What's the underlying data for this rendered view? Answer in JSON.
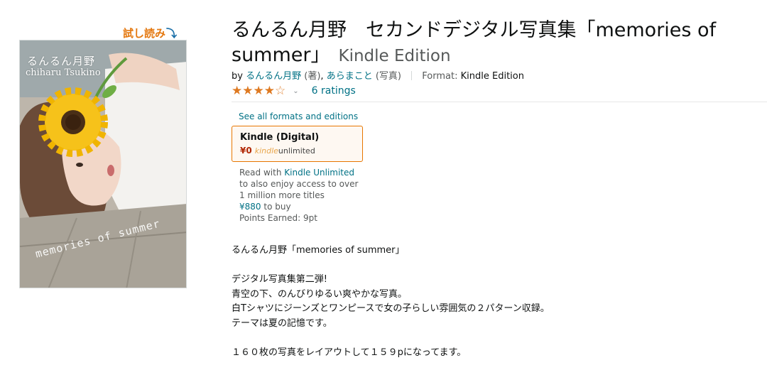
{
  "look_inside": {
    "label": "試し読み",
    "arrow": "⤵"
  },
  "cover": {
    "title_ja": "るんるん月野",
    "author_en": "chiharu Tsukino",
    "subtitle": "memories of summer"
  },
  "product": {
    "title": "るんるん月野　セカンドデジタル写真集「memories of summer」",
    "edition": "Kindle Edition",
    "by_label": "by",
    "contributors": [
      {
        "name": "るんるん月野",
        "role": "(著)",
        "separator": ","
      },
      {
        "name": "あらまこと",
        "role": "(写真)",
        "separator": ""
      }
    ],
    "format_label": "Format:",
    "format_value": "Kindle Edition"
  },
  "rating": {
    "stars": 4,
    "max_stars": 5,
    "ratings_count_label": "6 ratings"
  },
  "formats": {
    "see_all_label": "See all formats and editions",
    "selected": {
      "name": "Kindle (Digital)",
      "price": "¥0",
      "ku_kindle": "kindle",
      "ku_unlimited": "unlimited"
    }
  },
  "kindle_unlimited": {
    "read_with": "Read with",
    "ku_link": "Kindle Unlimited",
    "line2": "to also enjoy access to over",
    "line3": "1 million more titles",
    "buy_price": "¥880",
    "buy_suffix": " to buy",
    "points": "Points Earned: 9pt"
  },
  "description": {
    "heading": "るんるん月野「memories of summer」",
    "lines": [
      "デジタル写真集第二弾!",
      "青空の下、のんびりゆるい爽やかな写真。",
      "白Tシャツにジーンズとワンピースで女の子らしい雰囲気の２パターン収録。",
      "テーマは夏の記憶です。"
    ],
    "footer": "１６０枚の写真をレイアウトして１５９pになってます。"
  },
  "colors": {
    "link": "#007185",
    "price": "#b12704",
    "star": "#de7921",
    "format_border": "#e77600",
    "look_inside": "#e47911"
  }
}
